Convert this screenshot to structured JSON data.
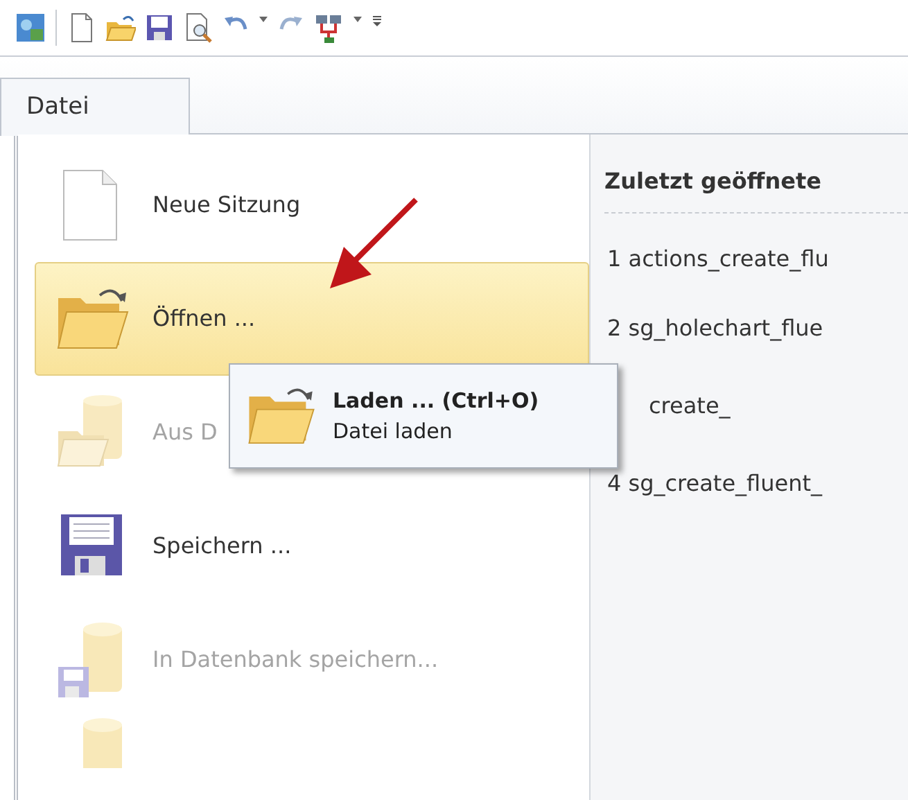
{
  "tabs": [
    {
      "label": "Datei",
      "selected": true
    }
  ],
  "menu": {
    "items": [
      {
        "label": "Neue Sitzung",
        "disabled": false,
        "selected": false
      },
      {
        "label": "Öffnen ...",
        "disabled": false,
        "selected": true
      },
      {
        "label": "Aus D",
        "disabled": true,
        "selected": false
      },
      {
        "label": "Speichern ...",
        "disabled": false,
        "selected": false
      },
      {
        "label": "In Datenbank speichern...",
        "disabled": true,
        "selected": false
      },
      {
        "disabled": true,
        "selected": false
      }
    ]
  },
  "submenu": {
    "title": "Laden ... (Ctrl+O)",
    "description": "Datei laden"
  },
  "recent": {
    "title": "Zuletzt geöffnete",
    "items": [
      {
        "label": "1 actions_create_flu"
      },
      {
        "label": "2 sg_holechart_flue"
      },
      {
        "label": "create_"
      },
      {
        "label": "4 sg_create_fluent_"
      }
    ]
  }
}
